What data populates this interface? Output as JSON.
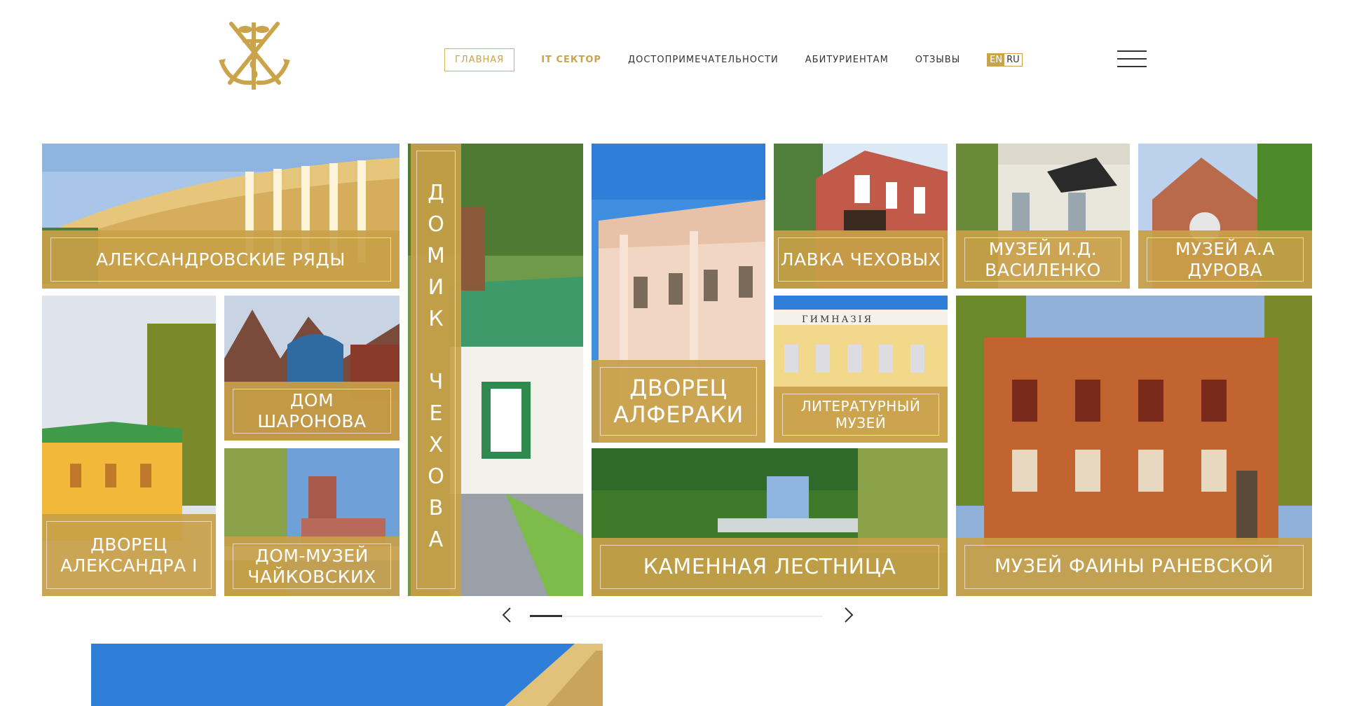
{
  "colors": {
    "accent": "#c9a44a",
    "text": "#333333",
    "background": "#ffffff"
  },
  "nav": {
    "items": [
      {
        "label": "ГЛАВНАЯ",
        "id": "home",
        "active": true
      },
      {
        "label": "IT СЕКТОР",
        "id": "it"
      },
      {
        "label": "ДОСТОПРИМЕЧАТЕЛЬНОСТИ",
        "id": "sights"
      },
      {
        "label": "АБИТУРИЕНТАМ",
        "id": "applicants"
      },
      {
        "label": "ОТЗЫВЫ",
        "id": "reviews"
      }
    ],
    "lang": {
      "en": "EN",
      "ru": "RU",
      "selected": "EN"
    }
  },
  "icons": {
    "logo": "anchor-hermes-logo-icon",
    "menu": "hamburger-menu-icon",
    "prev": "chevron-left-icon",
    "next": "chevron-right-icon"
  },
  "tiles": {
    "aleksandrovskie": "АЛЕКСАНДРОВСКИЕ РЯДЫ",
    "domik_chekhova": "ДОМИК ЧЕХОВА",
    "dvorets_alferaki": "ДВОРЕЦ АЛФЕРАКИ",
    "lavka_chekhovykh": "ЛАВКА ЧЕХОВЫХ",
    "muzei_vasilenko": "МУЗЕЙ И.Д. ВАСИЛЕНКО",
    "muzei_durova": "МУЗЕЙ А.А ДУРОВА",
    "dvorets_aleksandra": "ДВОРЕЦ АЛЕКСАНДРА I",
    "dom_sharonova": "ДОМ ШАРОНОВА",
    "dom_muzei_chaikovskikh": "ДОМ-МУЗЕЙ ЧАЙКОВСКИХ",
    "literaturnyi_muzei": "ЛИТЕРАТУРНЫЙ МУЗЕЙ",
    "kamennaya_lestnitsa": "КАМЕННАЯ ЛЕСТНИЦА",
    "muzei_ranevskoi": "МУЗЕЙ ФАИНЫ РАНЕВСКОЙ"
  },
  "gimnazia_sign": "ГИМНАЗIЯ",
  "carousel": {
    "progress": 0.11
  }
}
